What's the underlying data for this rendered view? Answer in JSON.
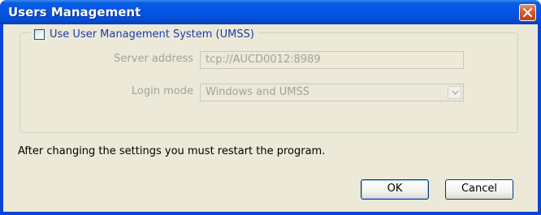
{
  "window": {
    "title": "Users Management"
  },
  "umss": {
    "checkbox_label": "Use User Management System (UMSS)",
    "checked": false
  },
  "fields": {
    "server_address_label": "Server address",
    "server_address_value": "tcp://AUCD0012:8989",
    "login_mode_label": "Login mode",
    "login_mode_value": "Windows and UMSS"
  },
  "note": "After changing the settings you must restart the program.",
  "buttons": {
    "ok": "OK",
    "cancel": "Cancel"
  },
  "colors": {
    "titlebar": "#0556e8",
    "dialog_bg": "#ece9d8",
    "disabled_text": "#a4a39a",
    "checkbox_label": "#1f3aa8",
    "close_button": "#d65a2c"
  }
}
